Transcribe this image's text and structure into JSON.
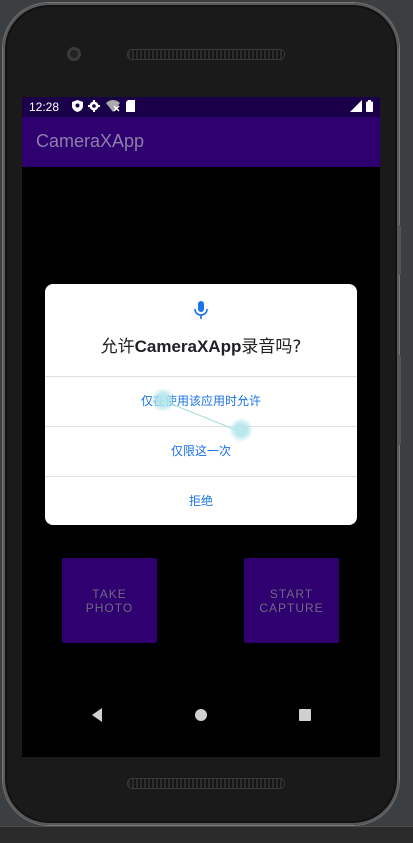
{
  "status_bar": {
    "time": "12:28",
    "left_icons": [
      "shield-icon",
      "gear-icon",
      "wifi-off-icon",
      "sim-card-icon"
    ],
    "right_icons": [
      "signal-icon",
      "battery-icon"
    ]
  },
  "app_bar": {
    "title": "CameraXApp"
  },
  "buttons": {
    "take_photo": "TAKE\nPHOTO",
    "start_capture": "START\nCAPTURE"
  },
  "permission_dialog": {
    "icon": "microphone-icon",
    "title_prefix": "允许",
    "title_app": "CameraXApp",
    "title_suffix": "录音吗?",
    "options": [
      "仅在使用该应用时允许",
      "仅限这一次",
      "拒绝"
    ]
  },
  "nav_bar": {
    "icons": [
      "back-icon",
      "home-icon",
      "recents-icon"
    ]
  },
  "colors": {
    "status_bar": "#1a0049",
    "app_bar": "#2e0070",
    "accent_text": "#1a73e8",
    "button_bg": "#2e0070"
  }
}
